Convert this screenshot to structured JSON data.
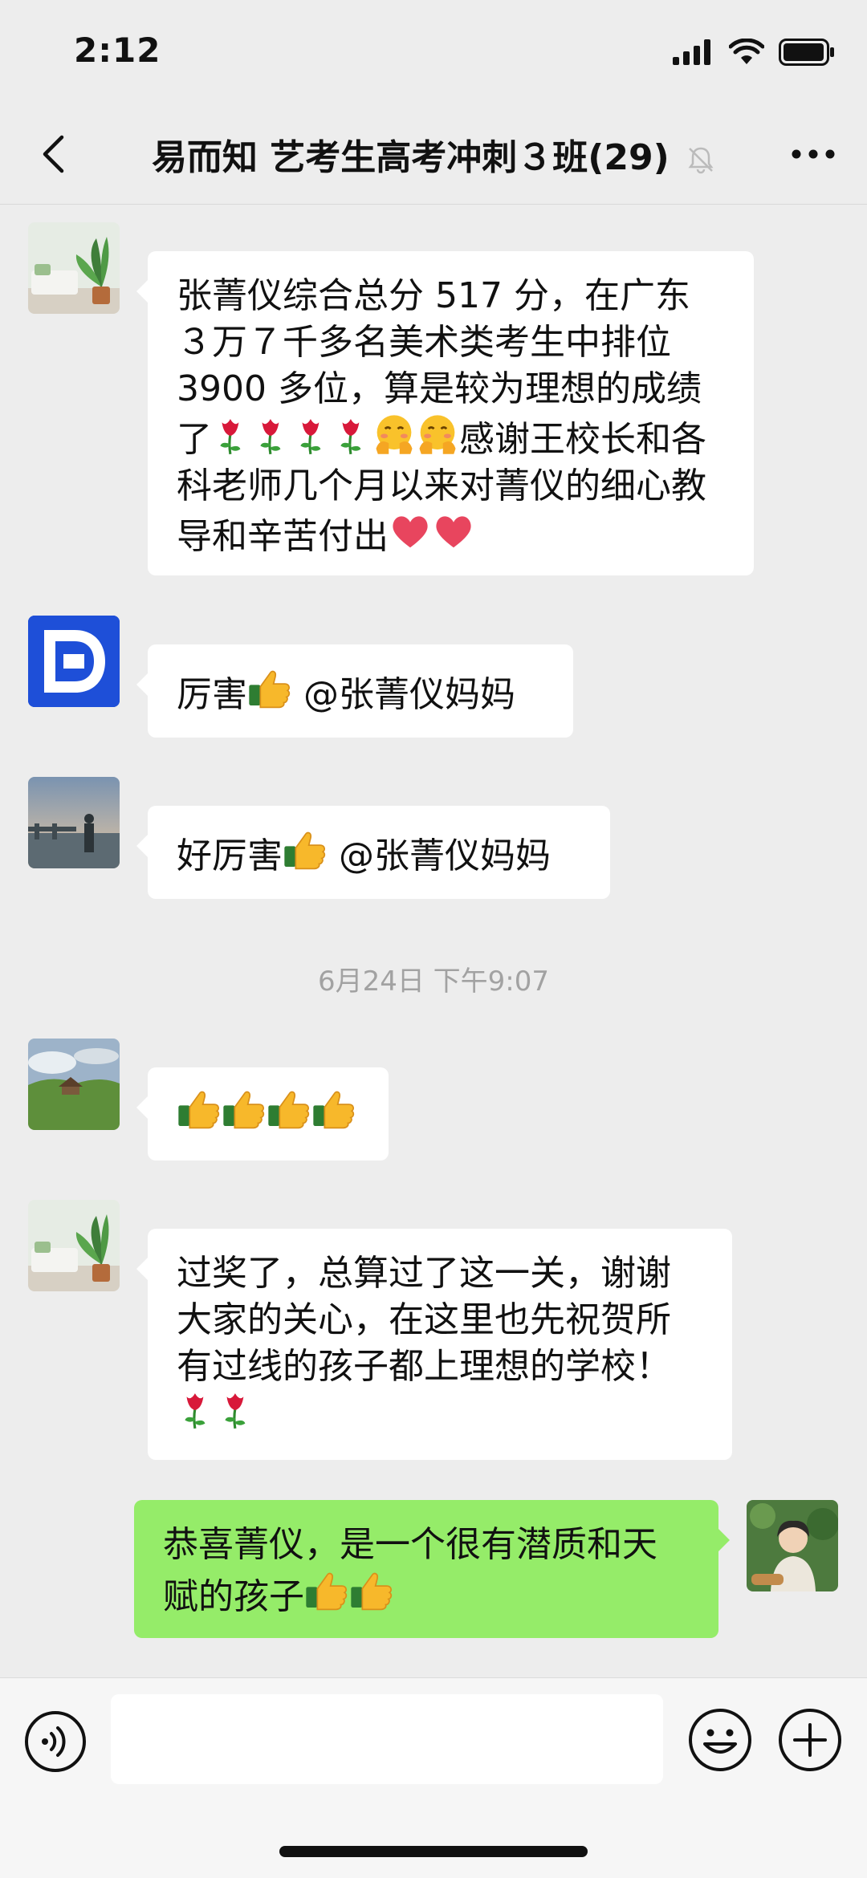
{
  "status": {
    "time": "2:12"
  },
  "header": {
    "title": "易而知 艺考生高考冲刺３班(29)"
  },
  "messages": [
    {
      "sender": "left",
      "text": "张菁仪综合总分 517 分，在广东３万７千多名美术类考生中排位3900 多位，算是较为理想的成绩了",
      "text_after": "感谢王校长和各科老师几个月以来对菁仪的细心教导和辛苦付出"
    },
    {
      "sender": "left",
      "text_before": "厉害",
      "text": "@张菁仪妈妈"
    },
    {
      "sender": "left",
      "text_before": "好厉害",
      "text": "@张菁仪妈妈"
    },
    {
      "sender": "left",
      "text": ""
    },
    {
      "sender": "left",
      "text": "过奖了，总算过了这一关，谢谢大家的关心，在这里也先祝贺所有过线的孩子都上理想的学校！"
    },
    {
      "sender": "me",
      "text": "恭喜菁仪，是一个很有潜质和天赋的孩子"
    }
  ],
  "timestamp": "6月24日 下午9:07",
  "colors": {
    "background": "#ededed",
    "bubble_mine": "#95ec69",
    "bubble_other": "#ffffff"
  },
  "icons": [
    "back-chevron-icon",
    "mute-bell-icon",
    "more-icon",
    "voice-icon",
    "emoji-icon",
    "plus-icon",
    "thumbs-up-icon",
    "rose-icon",
    "heart-icon",
    "hug-face-icon"
  ]
}
